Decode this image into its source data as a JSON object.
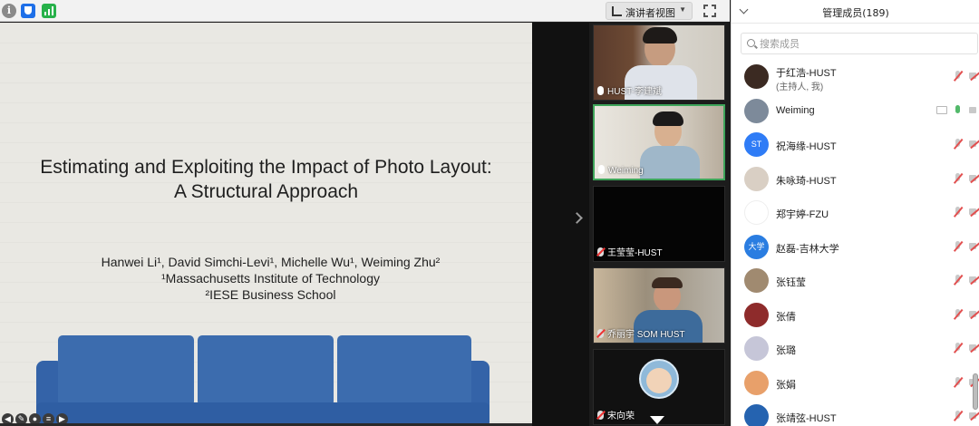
{
  "toolbar": {
    "info_icon": "info-icon",
    "shield_icon": "shield-icon",
    "signal_icon": "signal-icon",
    "view_mode_label": "演讲者视图",
    "view_mode_icon": "layout-icon",
    "fullscreen_icon": "fullscreen-icon"
  },
  "slide": {
    "title_line1": "Estimating and Exploiting the Impact of Photo Layout:",
    "title_line2": "A Structural Approach",
    "authors": "Hanwei Li¹, David Simchi-Levi¹, Michelle Wu¹, Weiming Zhu²",
    "affil1": "¹Massachusetts Institute of Technology",
    "affil2": "²IESE Business School"
  },
  "videos": [
    {
      "name": "HUST-李建斌",
      "mic": "on",
      "active": false
    },
    {
      "name": "Weiming",
      "mic": "on",
      "active": true
    },
    {
      "name": "王莹莹-HUST",
      "mic": "off",
      "active": false
    },
    {
      "name": "乔丽宇 SOM HUST",
      "mic": "off",
      "active": false
    },
    {
      "name": "宋向荣",
      "mic": "off",
      "active": false
    }
  ],
  "panel": {
    "title": "管理成员(189)",
    "search_placeholder": "搜索成员",
    "participants": [
      {
        "name": "于红浩-HUST",
        "sub": "(主持人, 我)",
        "avatar_text": "",
        "avatar_color": "#3b2a22",
        "mic": "off",
        "cam": "off",
        "screen": false
      },
      {
        "name": "Weiming",
        "sub": "",
        "avatar_text": "",
        "avatar_color": "#7d8a9a",
        "mic": "on",
        "cam": "plain",
        "screen": true
      },
      {
        "name": "祝海缘-HUST",
        "sub": "",
        "avatar_text": "ST",
        "avatar_color": "#2f7cf6",
        "mic": "off",
        "cam": "off",
        "screen": false
      },
      {
        "name": "朱咏琦-HUST",
        "sub": "",
        "avatar_text": "",
        "avatar_color": "#d9cfc4",
        "mic": "off",
        "cam": "off",
        "screen": false
      },
      {
        "name": "郑宇婷-FZU",
        "sub": "",
        "avatar_text": "",
        "avatar_color": "#ffffff",
        "mic": "off",
        "cam": "off",
        "screen": false
      },
      {
        "name": "赵磊-吉林大学",
        "sub": "",
        "avatar_text": "大学",
        "avatar_color": "#2a7de1",
        "mic": "off",
        "cam": "off",
        "screen": false
      },
      {
        "name": "张钰莹",
        "sub": "",
        "avatar_text": "",
        "avatar_color": "#a08a70",
        "mic": "off",
        "cam": "off",
        "screen": false
      },
      {
        "name": "张倩",
        "sub": "",
        "avatar_text": "",
        "avatar_color": "#8e2b2b",
        "mic": "off",
        "cam": "off",
        "screen": false
      },
      {
        "name": "张璐",
        "sub": "",
        "avatar_text": "",
        "avatar_color": "#c6c6d8",
        "mic": "off",
        "cam": "off",
        "screen": false
      },
      {
        "name": "张娟",
        "sub": "",
        "avatar_text": "",
        "avatar_color": "#e8a06a",
        "mic": "off",
        "cam": "off",
        "screen": false
      },
      {
        "name": "张靖弦-HUST",
        "sub": "",
        "avatar_text": "",
        "avatar_color": "#2563b0",
        "mic": "off",
        "cam": "off",
        "screen": false
      }
    ]
  },
  "colors": {
    "accent_blue": "#2f7cf6",
    "active_green": "#3ea55a",
    "muted_red": "#e25050"
  }
}
